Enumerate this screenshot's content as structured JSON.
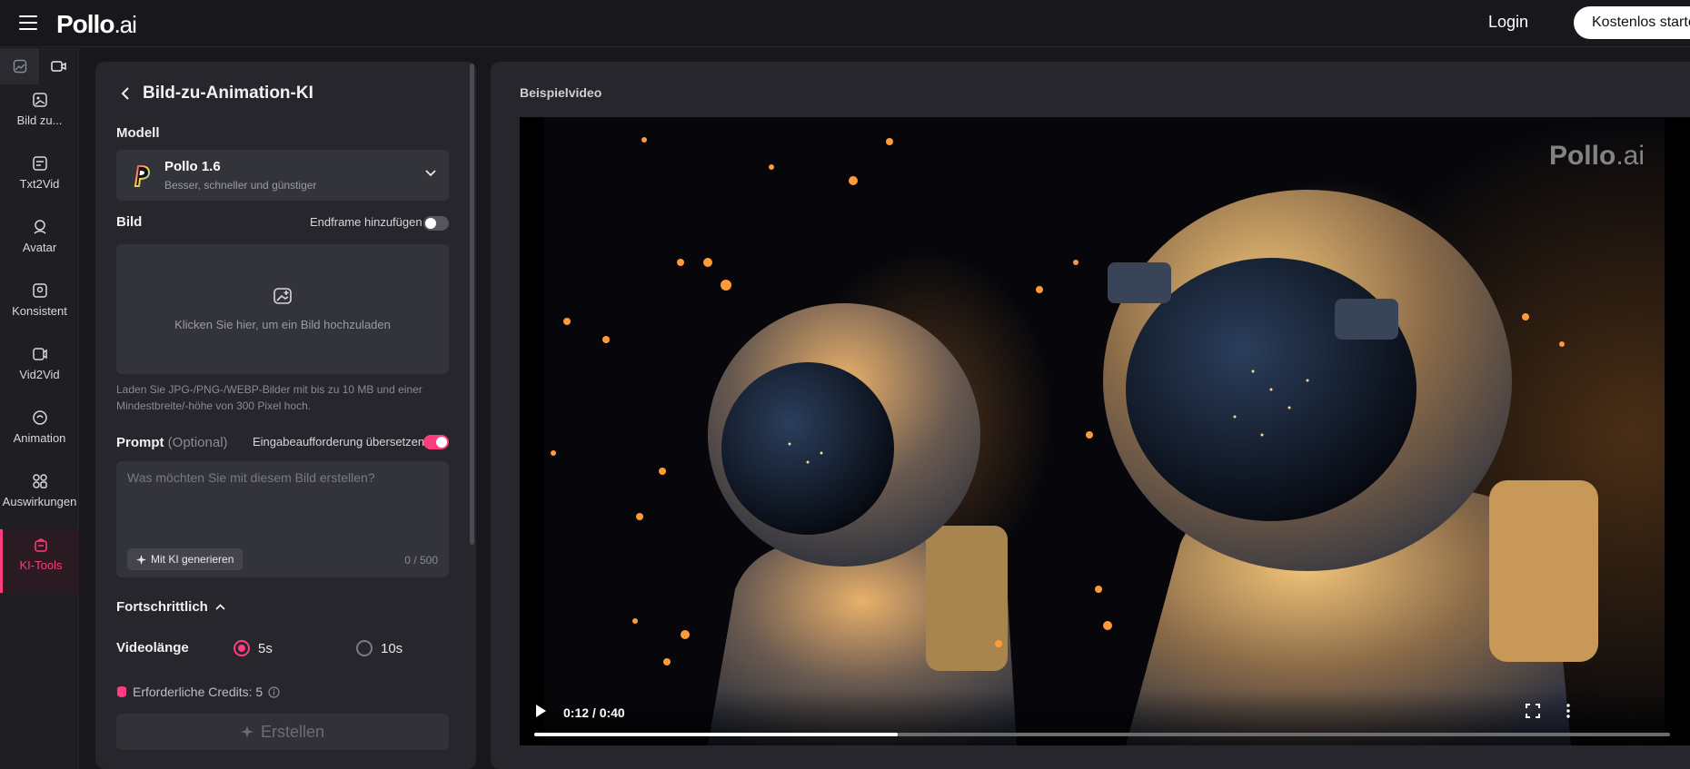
{
  "header": {
    "logo_main": "Pollo",
    "logo_suffix": ".ai",
    "login_label": "Login",
    "cta_label": "Kostenlos starte"
  },
  "sidebar": {
    "items": [
      {
        "label": "Bild zu..."
      },
      {
        "label": "Txt2Vid"
      },
      {
        "label": "Avatar"
      },
      {
        "label": "Konsistent"
      },
      {
        "label": "Vid2Vid"
      },
      {
        "label": "Animation"
      },
      {
        "label": "Auswirkungen"
      },
      {
        "label": "KI-Tools"
      }
    ]
  },
  "panel": {
    "title": "Bild-zu-Animation-KI",
    "model_label": "Modell",
    "model_name": "Pollo 1.6",
    "model_subtitle": "Besser, schneller und günstiger",
    "image_label": "Bild",
    "endframe_label": "Endframe hinzufügen",
    "upload_text": "Klicken Sie hier, um ein Bild hochzuladen",
    "upload_hint": "Laden Sie JPG-/PNG-/WEBP-Bilder mit bis zu 10 MB und einer Mindestbreite/-höhe von 300 Pixel hoch.",
    "prompt_label": "Prompt",
    "prompt_optional": "(Optional)",
    "translate_label": "Eingabeaufforderung übersetzen",
    "prompt_placeholder": "Was möchten Sie mit diesem Bild erstellen?",
    "generate_label": "Mit KI generieren",
    "char_counter": "0 / 500",
    "advanced_label": "Fortschrittlich",
    "video_length_label": "Videolänge",
    "option_5s": "5s",
    "option_10s": "10s",
    "selected_length": "5s",
    "credits_label": "Erforderliche Credits: 5",
    "create_label": "Erstellen"
  },
  "main": {
    "title": "Beispielvideo",
    "watermark_main": "Pollo",
    "watermark_suffix": ".ai",
    "time": "0:12 / 0:40",
    "progress": 0.32
  },
  "colors": {
    "accent": "#ff3d7f",
    "background": "#18181c",
    "panel": "#26262c"
  },
  "icons": [
    "menu-icon",
    "image-tab-icon",
    "video-tab-icon",
    "back-arrow-icon",
    "chevron-down-icon",
    "upload-image-icon",
    "sparkle-icon",
    "credits-icon",
    "info-icon",
    "play-icon",
    "fullscreen-icon",
    "more-icon"
  ]
}
